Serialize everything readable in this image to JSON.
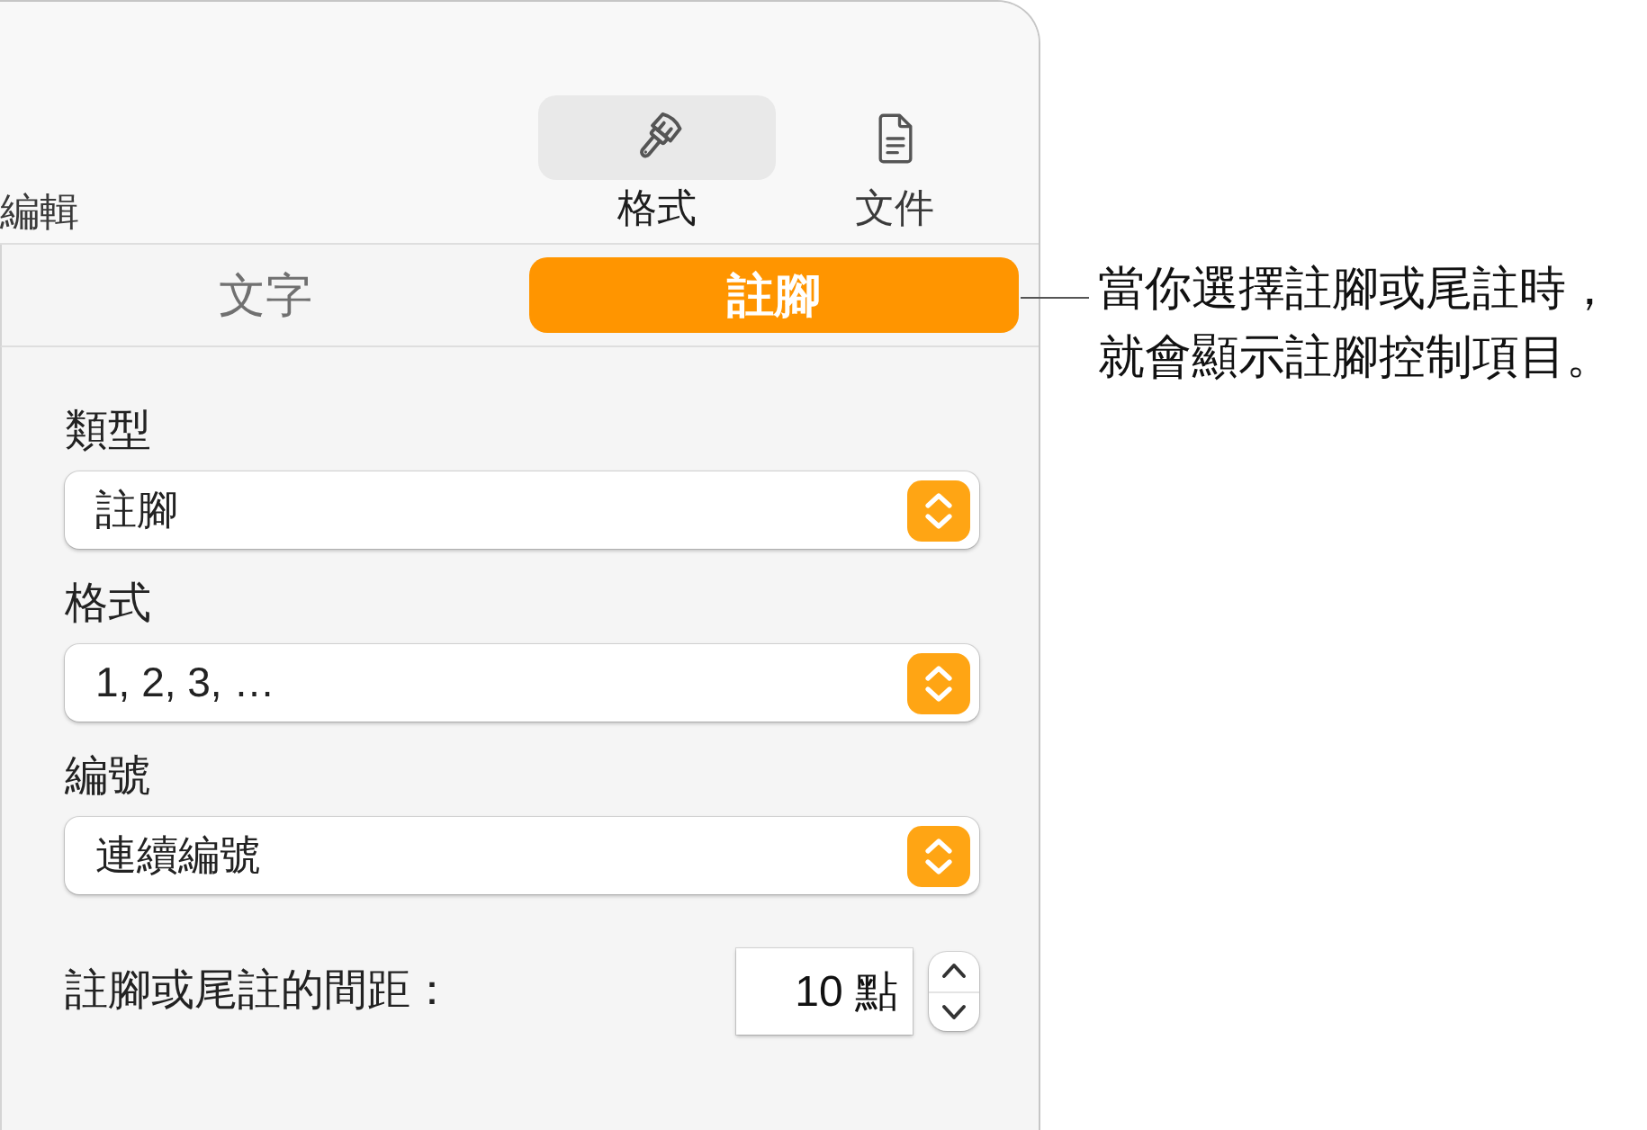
{
  "toolbar": [
    {
      "kind": "text",
      "label": "編輯",
      "selected": false
    },
    {
      "kind": "brush",
      "label": "格式",
      "selected": true
    },
    {
      "kind": "document",
      "label": "文件",
      "selected": false
    }
  ],
  "tabs": [
    {
      "label": "文字",
      "selected": false
    },
    {
      "label": "註腳",
      "selected": true
    }
  ],
  "fields": [
    {
      "label": "類型",
      "value": "註腳"
    },
    {
      "label": "格式",
      "value": "1, 2, 3, …"
    },
    {
      "label": "編號",
      "value": "連續編號"
    }
  ],
  "spacing": {
    "label": "註腳或尾註的間距：",
    "value": "10 點"
  },
  "callout": {
    "lines": [
      "當你選擇註腳或尾註時，",
      "就會顯示註腳控制項目。"
    ]
  }
}
